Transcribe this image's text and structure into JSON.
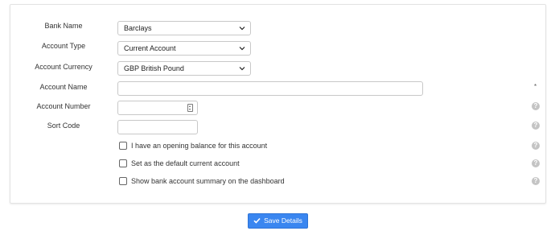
{
  "form": {
    "bank_name": {
      "label": "Bank Name",
      "value": "Barclays"
    },
    "account_type": {
      "label": "Account Type",
      "value": "Current Account"
    },
    "account_currency": {
      "label": "Account Currency",
      "value": "GBP British Pound"
    },
    "account_name": {
      "label": "Account Name",
      "value": "",
      "required_marker": "*"
    },
    "account_number": {
      "label": "Account Number",
      "value": ""
    },
    "sort_code": {
      "label": "Sort Code",
      "value": ""
    },
    "checkboxes": [
      {
        "label": "I have an opening balance for this account",
        "checked": false
      },
      {
        "label": "Set as the default current account",
        "checked": false
      },
      {
        "label": "Show bank account summary on the dashboard",
        "checked": false
      }
    ],
    "help_symbol": "?"
  },
  "actions": {
    "save_label": "Save Details",
    "save_icon": "check-icon",
    "save_color": "#3a86f0"
  },
  "icons": {
    "select_chevron": "chevron-down-icon",
    "help": "question-circle-icon",
    "number_spinner": "spinner-icon"
  }
}
